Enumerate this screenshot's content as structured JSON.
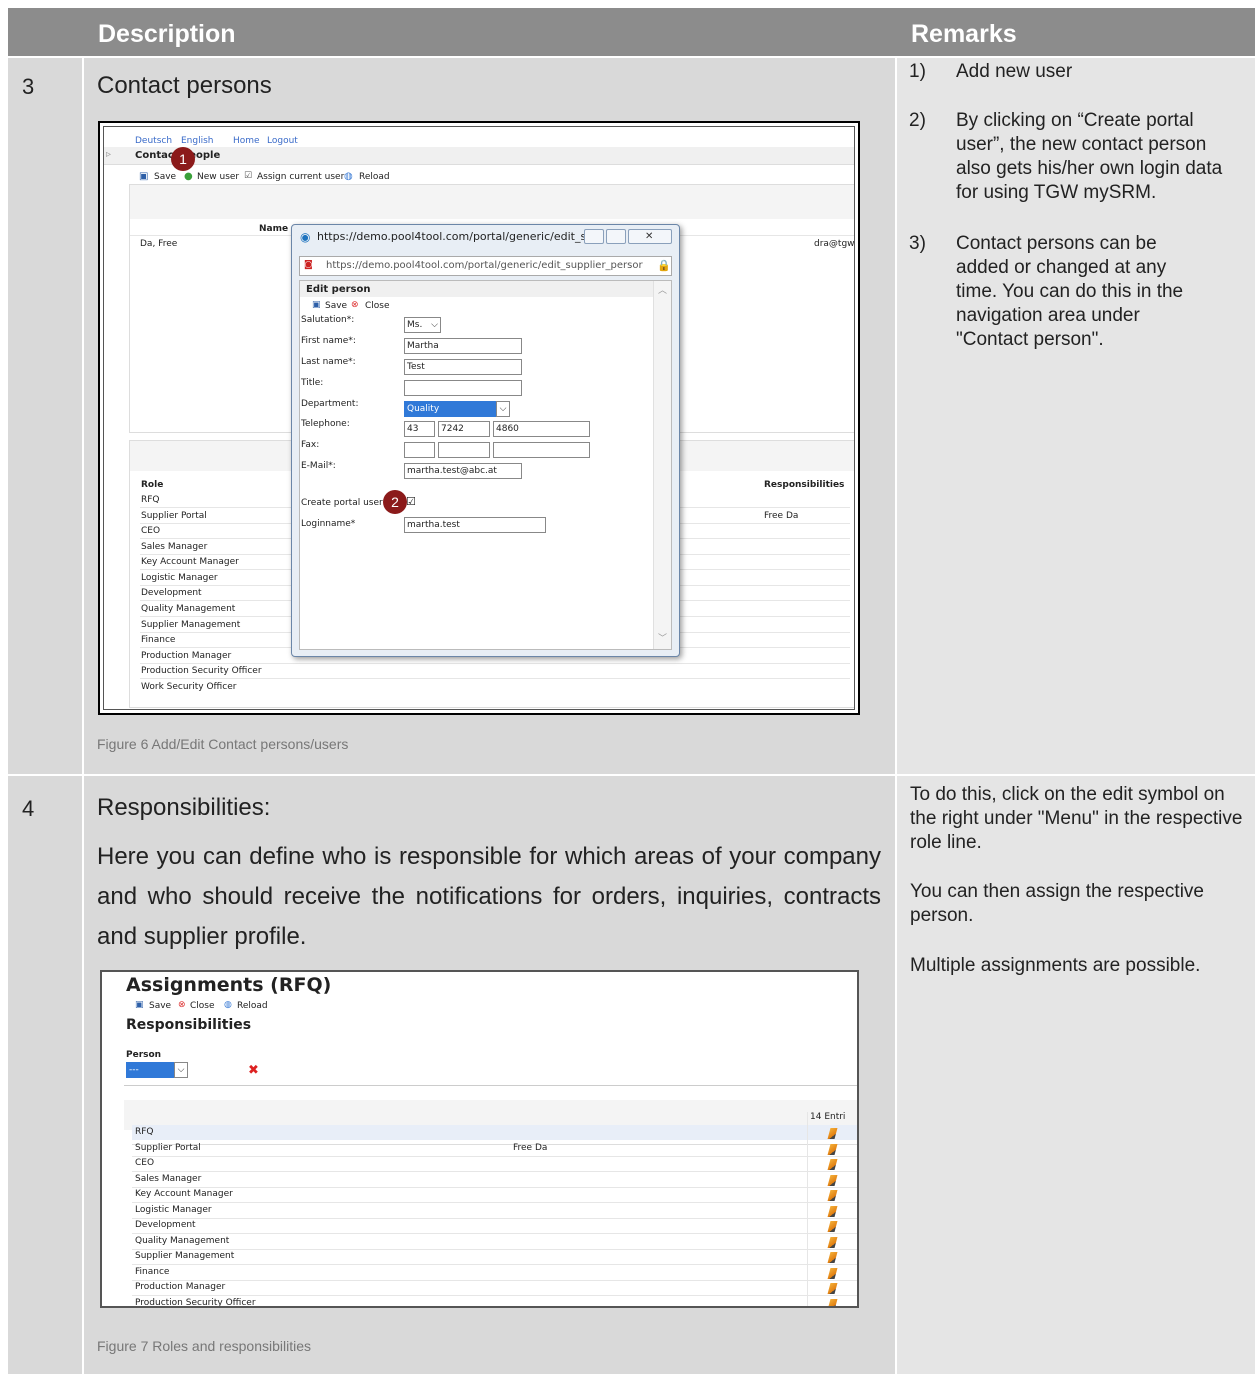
{
  "header": {
    "description": "Description",
    "remarks": "Remarks"
  },
  "section3": {
    "number": "3",
    "title": "Contact persons",
    "caption": "Figure 6 Add/Edit Contact persons/users",
    "remarks": [
      {
        "n": "1)",
        "text": "Add new user"
      },
      {
        "n": "2)",
        "text": "By clicking on “Create portal user”, the new contact person also gets his/her own login data for using TGW mySRM."
      },
      {
        "n": "3)",
        "text": "Contact persons can be added or changed at any time. You can do this in the navigation area under \"Contact person\"."
      }
    ],
    "screenshot": {
      "lang_de": "Deutsch",
      "lang_en": "English",
      "nav_home": "Home",
      "nav_logout": "Logout",
      "page_title": "Contact people",
      "toolbar": {
        "save": "Save",
        "new_user": "New user",
        "assign": "Assign current user",
        "reload": "Reload"
      },
      "col_name": "Name",
      "contact_name": "Da, Free",
      "contact_email": "dra@tgw.a",
      "role_header": "Role",
      "resp_header": "Responsibilities",
      "roles": [
        "RFQ",
        "Supplier Portal",
        "CEO",
        "Sales Manager",
        "Key Account Manager",
        "Logistic Manager",
        "Development",
        "Quality Management",
        "Supplier Management",
        "Finance",
        "Production Manager",
        "Production Security Officer",
        "Work Security Officer"
      ],
      "supplier_portal_resp": "Free Da",
      "marker1": "1",
      "marker2": "2",
      "popup": {
        "title_url": "https://demo.pool4tool.com/portal/generic/edit_s...",
        "address_url": "https://demo.pool4tool.com/portal/generic/edit_supplier_persor",
        "heading": "Edit person",
        "save": "Save",
        "close": "Close",
        "salutation_label": "Salutation*:",
        "salutation_value": "Ms.",
        "first_name_label": "First name*:",
        "first_name_value": "Martha",
        "last_name_label": "Last name*:",
        "last_name_value": "Test",
        "title_label": "Title:",
        "department_label": "Department:",
        "department_value": "Quality",
        "telephone_label": "Telephone:",
        "tel_country": "43",
        "tel_area": "7242",
        "tel_number": "4860",
        "fax_label": "Fax:",
        "email_label": "E-Mail*:",
        "email_value": "martha.test@abc.at",
        "create_portal_label": "Create portal user",
        "login_label": "Loginname*",
        "login_value": "martha.test"
      }
    }
  },
  "section4": {
    "number": "4",
    "title": "Responsibilities:",
    "paragraph": "Here you can define who is responsible for which areas of your company and who should receive the notifications for orders, inquiries, contracts and supplier profile.",
    "caption": "Figure 7 Roles and responsibilities",
    "remarks": [
      "To do this, click on the edit symbol on the right under \"Menu\" in the respective role line.",
      "You can then assign the respective person.",
      "Multiple assignments are possible."
    ],
    "screenshot": {
      "title": "Assignments (RFQ)",
      "toolbar": {
        "save": "Save",
        "close": "Close",
        "reload": "Reload"
      },
      "subtitle": "Responsibilities",
      "person_label": "Person",
      "person_value": "---",
      "entries": "14 Entri",
      "roles": [
        "RFQ",
        "Supplier Portal",
        "CEO",
        "Sales Manager",
        "Key Account Manager",
        "Logistic Manager",
        "Development",
        "Quality Management",
        "Supplier Management",
        "Finance",
        "Production Manager",
        "Production Security Officer"
      ],
      "supplier_portal_person": "Free Da"
    }
  }
}
